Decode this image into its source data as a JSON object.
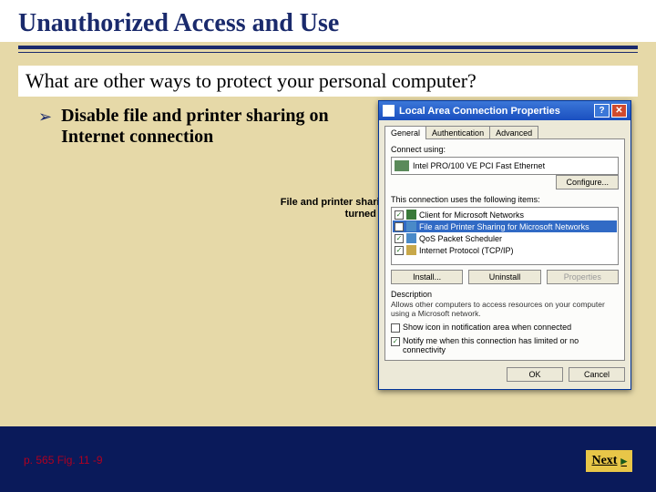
{
  "title": "Unauthorized Access and Use",
  "question": "What are other ways to protect your personal computer?",
  "bullet": "Disable file and printer sharing on Internet connection",
  "callout": "File and printer sharing turned off",
  "page_ref": "p. 565 Fig. 11 -9",
  "next_label": "Next",
  "dialog": {
    "title": "Local Area Connection Properties",
    "tabs": [
      "General",
      "Authentication",
      "Advanced"
    ],
    "connect_using_label": "Connect using:",
    "adapter": "Intel PRO/100 VE PCI Fast Ethernet",
    "configure_btn": "Configure...",
    "items_label": "This connection uses the following items:",
    "items": [
      {
        "checked": true,
        "label": "Client for Microsoft Networks"
      },
      {
        "checked": false,
        "label": "File and Printer Sharing for Microsoft Networks",
        "highlight": true
      },
      {
        "checked": true,
        "label": "QoS Packet Scheduler"
      },
      {
        "checked": true,
        "label": "Internet Protocol (TCP/IP)"
      }
    ],
    "install_btn": "Install...",
    "uninstall_btn": "Uninstall",
    "properties_btn": "Properties",
    "desc_label": "Description",
    "desc_text": "Allows other computers to access resources on your computer using a Microsoft network.",
    "show_icon": {
      "checked": false,
      "label": "Show icon in notification area when connected"
    },
    "notify": {
      "checked": true,
      "label": "Notify me when this connection has limited or no connectivity"
    },
    "ok_btn": "OK",
    "cancel_btn": "Cancel"
  }
}
